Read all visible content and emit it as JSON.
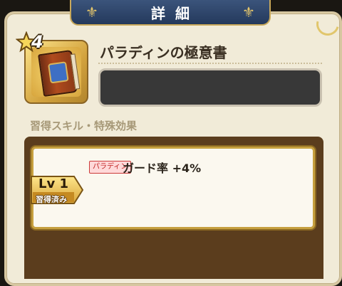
{
  "header": {
    "title": "詳細"
  },
  "item": {
    "rarity": "4",
    "name": "パラディンの極意書",
    "icon": "spellbook-icon"
  },
  "section": {
    "label": "習得スキル・特殊効果"
  },
  "skills": [
    {
      "class_tag": "パラディン",
      "effect": "ガード率 +4%",
      "level": "Lv 1",
      "status": "習得済み"
    }
  ],
  "colors": {
    "header_bg": "#2e4569",
    "accent_gold": "#c8a85a",
    "panel_bg": "#f1ebd8",
    "list_bg": "#5b3d1d",
    "class_tag_red": "#c02525"
  }
}
